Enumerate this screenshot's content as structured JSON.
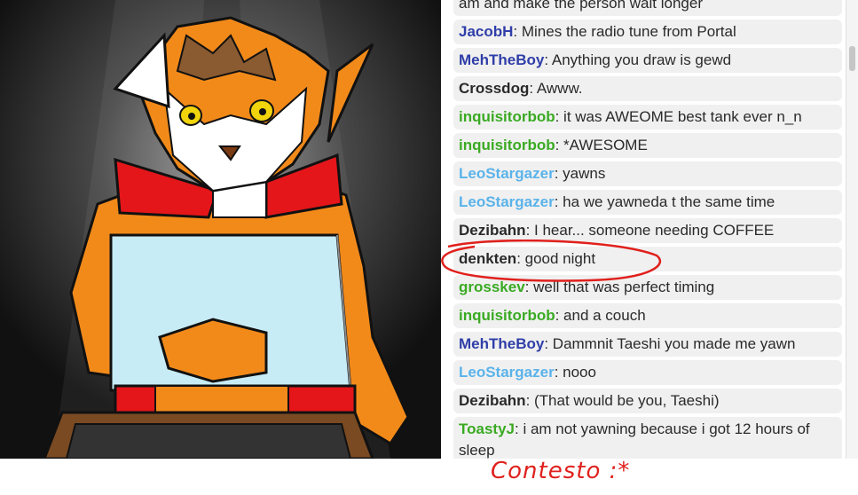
{
  "chat": {
    "messages": [
      {
        "user": "",
        "color": "#2a2a2a",
        "text": "am and make the person wait longer"
      },
      {
        "user": "JacobH",
        "color": "#2f3ea8",
        "text": ": Mines the radio tune from Portal"
      },
      {
        "user": "MehTheBoy",
        "color": "#2f3ea8",
        "text": ": Anything you draw is gewd"
      },
      {
        "user": "Crossdog",
        "color": "#2a2a2a",
        "text": ": Awww."
      },
      {
        "user": "inquisitorbob",
        "color": "#3aaa23",
        "text": ": it was AWEOME best tank ever n_n"
      },
      {
        "user": "inquisitorbob",
        "color": "#3aaa23",
        "text": ": *AWESOME"
      },
      {
        "user": "LeoStargazer",
        "color": "#5ab3ea",
        "text": ": yawns"
      },
      {
        "user": "LeoStargazer",
        "color": "#5ab3ea",
        "text": ": ha we yawneda t the same time"
      },
      {
        "user": "Dezibahn",
        "color": "#2a2a2a",
        "text": ": I hear... someone needing COFFEE"
      },
      {
        "user": "denkten",
        "color": "#2a2a2a",
        "text": ": good night"
      },
      {
        "user": "grosskev",
        "color": "#3aaa23",
        "text": ": well that was perfect timing"
      },
      {
        "user": "inquisitorbob",
        "color": "#3aaa23",
        "text": ": and a couch"
      },
      {
        "user": "MehTheBoy",
        "color": "#2f3ea8",
        "text": ": Dammnit Taeshi you made me yawn"
      },
      {
        "user": "LeoStargazer",
        "color": "#5ab3ea",
        "text": ": nooo"
      },
      {
        "user": "Dezibahn",
        "color": "#2a2a2a",
        "text": ": (That would be you, Taeshi)"
      },
      {
        "user": "ToastyJ",
        "color": "#3aaa23",
        "text": ": i am not yawning because i got 12 hours of sleep"
      }
    ]
  },
  "annotation": {
    "text": "Contesto :*",
    "color": "#e0201c"
  },
  "artwork": {
    "subject": "cartoon orange fox character holding a blanket in front of a keyboard"
  }
}
